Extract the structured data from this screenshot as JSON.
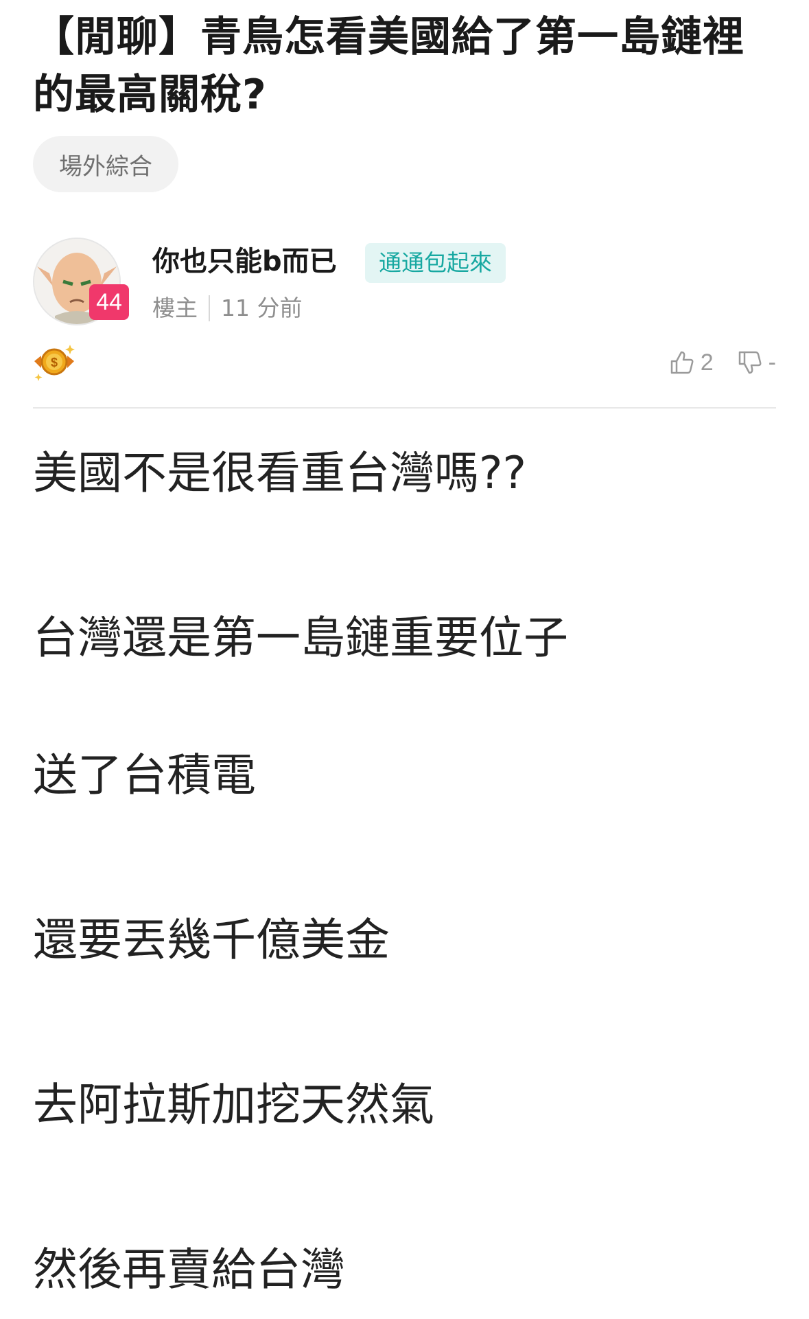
{
  "post": {
    "title": "【閒聊】青鳥怎看美國給了第一島鏈裡的最高關稅?",
    "board": "場外綜合"
  },
  "author": {
    "name": "你也只能b而已",
    "tag": "通通包起來",
    "level": "44",
    "role": "樓主",
    "time": "11 分前"
  },
  "reactions": {
    "likes": "2",
    "dislikes": "-"
  },
  "content": {
    "lines": [
      "美國不是很看重台灣嗎??",
      "台灣還是第一島鏈重要位子",
      "送了台積電",
      "還要丟幾千億美金",
      "去阿拉斯加挖天然氣",
      "然後再賣給台灣"
    ]
  },
  "colors": {
    "level_badge": "#f0386b",
    "tag_text": "#17a8a1",
    "tag_bg": "#e3f5f4",
    "coin": "#f0a91c"
  },
  "icons": {
    "like": "thumbs-up-icon",
    "dislike": "thumbs-down-icon",
    "coin": "gold-coin-icon"
  }
}
